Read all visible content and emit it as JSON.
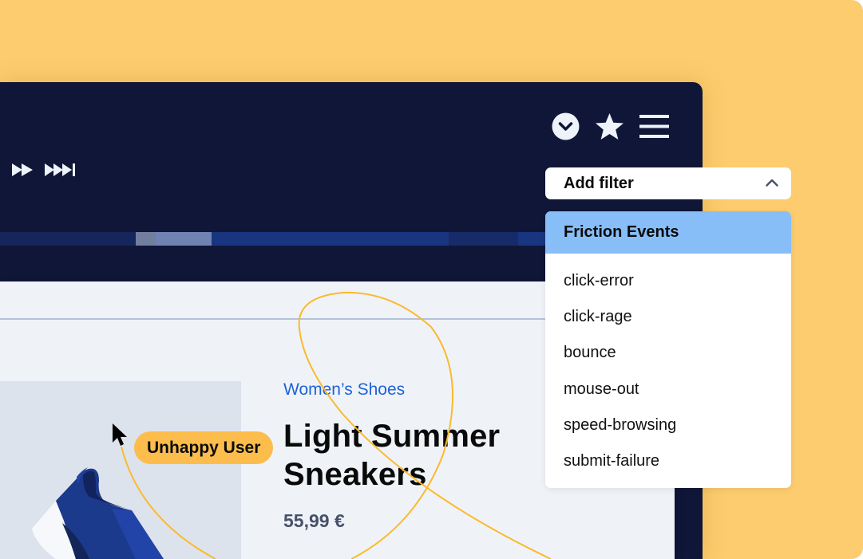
{
  "colors": {
    "background": "#fccc6e",
    "player_bg": "#0f1638",
    "accent_yellow": "#fcbd4c",
    "menu_header": "#88bef8",
    "link_blue": "#1e62d8"
  },
  "player": {
    "controls": [
      {
        "icon": "fast-forward-icon",
        "label": "Fast forward"
      },
      {
        "icon": "skip-to-end-icon",
        "label": "Skip to end"
      }
    ],
    "top_icons": [
      "chevron-down-circle-icon",
      "star-icon",
      "hamburger-menu-icon"
    ],
    "timeline": {
      "segments": [
        {
          "fraction": 0.243,
          "color": "#16255b"
        },
        {
          "fraction": 0.036,
          "color": "#717e9e"
        },
        {
          "fraction": 0.1,
          "color": "#7082b2"
        },
        {
          "fraction": 0.424,
          "color": "#1a3580"
        },
        {
          "fraction": 0.124,
          "color": "#162b68"
        },
        {
          "fraction": 0.073,
          "color": "#1a3580"
        }
      ]
    }
  },
  "page": {
    "category_link": "Women’s Shoes",
    "product_title_line1": "Light Summer",
    "product_title_line2": "Sneakers",
    "price": "55,99 €"
  },
  "annotation": {
    "badge": "Unhappy User"
  },
  "filter": {
    "button_label": "Add filter",
    "menu_header": "Friction Events",
    "options": [
      "click-error",
      "click-rage",
      "bounce",
      "mouse-out",
      "speed-browsing",
      "submit-failure"
    ]
  }
}
